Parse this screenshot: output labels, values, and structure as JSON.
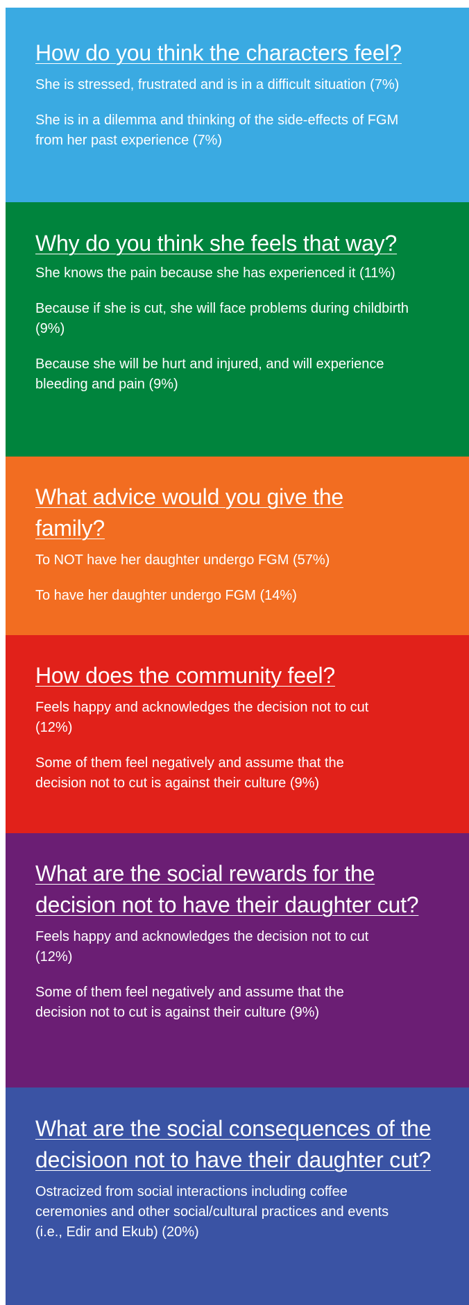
{
  "colors": {
    "light_blue": "#3aaae2",
    "green": "#00843d",
    "orange": "#f26d21",
    "red": "#e1211a",
    "purple": "#6b1e74",
    "blue": "#3a53a4",
    "text": "#ffffff"
  },
  "sections": [
    {
      "heading": "How do you think the characters feel?",
      "items": [
        "She is stressed, frustrated and is in a difficult situation (7%)",
        "She is in a dilemma and thinking of the side-effects of FGM from her past experience (7%)"
      ]
    },
    {
      "heading": "Why do you think she feels that way?",
      "items": [
        "She knows the pain because she has experienced it (11%)",
        "Because if she is cut, she will face problems during childbirth (9%)",
        "Because she will be hurt and injured, and will experience bleeding and pain (9%)"
      ]
    },
    {
      "heading": "What advice would you give the family?",
      "items": [
        "To NOT have her daughter undergo FGM (57%)",
        "To have her daughter undergo FGM (14%)"
      ]
    },
    {
      "heading": "How does the community feel?",
      "items": [
        "Feels happy and acknowledges the decision not to cut (12%)",
        "Some of them feel negatively and assume that the decision not to cut is against their culture (9%)"
      ]
    },
    {
      "heading": "What are the social rewards for the decision not to have their daughter cut?",
      "items": [
        "Feels happy and acknowledges the decision not to cut (12%)",
        "Some of them feel negatively and assume that the decision not to cut is against their culture (9%)"
      ]
    },
    {
      "heading": "What are the social consequences of the decisioon not to have their daughter cut?",
      "items": [
        "Ostracized from social interactions including coffee ceremonies and other social/cultural practices and events (i.e., Edir and Ekub) (20%)"
      ]
    }
  ]
}
